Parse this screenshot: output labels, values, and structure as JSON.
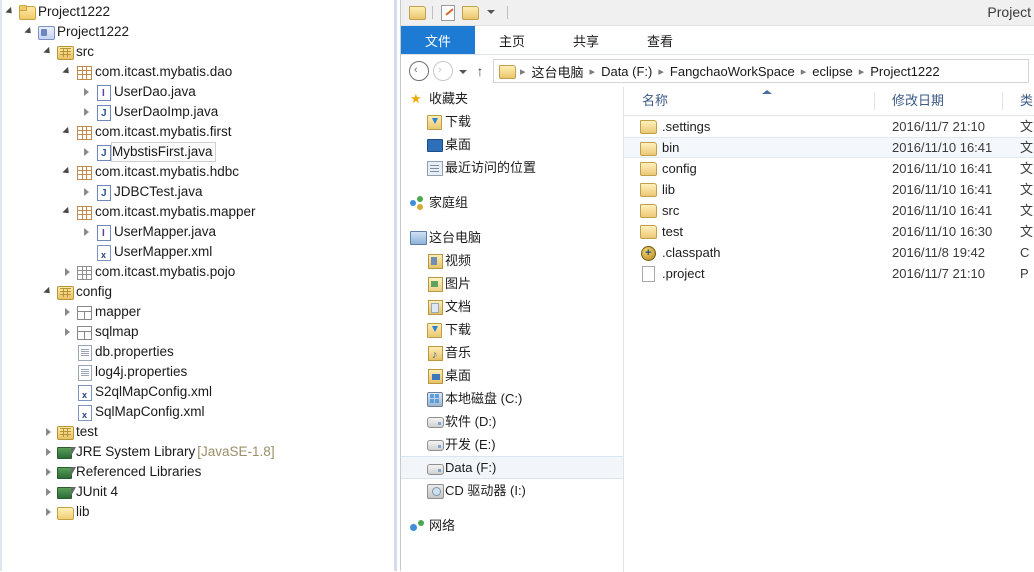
{
  "eclipse": {
    "tree": [
      {
        "depth": 0,
        "arrow": "expanded",
        "icon": "i-proj",
        "label": "Project1222"
      },
      {
        "depth": 1,
        "arrow": "expanded",
        "icon": "i-projj",
        "label": "Project1222"
      },
      {
        "depth": 2,
        "arrow": "expanded",
        "icon": "i-srcfolder",
        "label": "src"
      },
      {
        "depth": 3,
        "arrow": "expanded",
        "icon": "i-pkg",
        "label": "com.itcast.mybatis.dao"
      },
      {
        "depth": 4,
        "arrow": "collapsed",
        "icon": "i-iface",
        "label": "UserDao.java"
      },
      {
        "depth": 4,
        "arrow": "collapsed",
        "icon": "i-java",
        "label": "UserDaoImp.java"
      },
      {
        "depth": 3,
        "arrow": "expanded",
        "icon": "i-pkg",
        "label": "com.itcast.mybatis.first"
      },
      {
        "depth": 4,
        "arrow": "collapsed",
        "icon": "i-java",
        "label": "MybstisFirst.java",
        "selected": true
      },
      {
        "depth": 3,
        "arrow": "expanded",
        "icon": "i-pkg",
        "label": "com.itcast.mybatis.hdbc"
      },
      {
        "depth": 4,
        "arrow": "collapsed",
        "icon": "i-java",
        "label": "JDBCTest.java"
      },
      {
        "depth": 3,
        "arrow": "expanded",
        "icon": "i-pkg",
        "label": "com.itcast.mybatis.mapper"
      },
      {
        "depth": 4,
        "arrow": "collapsed",
        "icon": "i-iface",
        "label": "UserMapper.java"
      },
      {
        "depth": 4,
        "arrow": "none",
        "icon": "i-xml",
        "label": "UserMapper.xml"
      },
      {
        "depth": 3,
        "arrow": "collapsed",
        "icon": "i-pkg",
        "label": "com.itcast.mybatis.pojo"
      },
      {
        "depth": 2,
        "arrow": "expanded",
        "icon": "i-srcfolder",
        "label": "config"
      },
      {
        "depth": 3,
        "arrow": "collapsed",
        "icon": "i-mapfolder",
        "label": "mapper"
      },
      {
        "depth": 3,
        "arrow": "collapsed",
        "icon": "i-mapfolder",
        "label": "sqlmap"
      },
      {
        "depth": 3,
        "arrow": "none",
        "icon": "i-prop",
        "label": "db.properties"
      },
      {
        "depth": 3,
        "arrow": "none",
        "icon": "i-prop",
        "label": "log4j.properties"
      },
      {
        "depth": 3,
        "arrow": "none",
        "icon": "i-xml",
        "label": "S2qlMapConfig.xml"
      },
      {
        "depth": 3,
        "arrow": "none",
        "icon": "i-xml",
        "label": "SqlMapConfig.xml"
      },
      {
        "depth": 2,
        "arrow": "collapsed",
        "icon": "i-srcfolder",
        "label": "test"
      },
      {
        "depth": 2,
        "arrow": "collapsed",
        "icon": "i-lib",
        "label": "JRE System Library",
        "sublabel": "[JavaSE-1.8]"
      },
      {
        "depth": 2,
        "arrow": "collapsed",
        "icon": "i-lib",
        "label": "Referenced Libraries"
      },
      {
        "depth": 2,
        "arrow": "collapsed",
        "icon": "i-lib",
        "label": "JUnit 4"
      },
      {
        "depth": 2,
        "arrow": "collapsed",
        "icon": "i-folder",
        "label": "lib"
      }
    ]
  },
  "explorer": {
    "title": "Project",
    "quick_access": [
      {
        "name": "folder-icon",
        "class": "fico"
      },
      {
        "name": "properties-icon",
        "class": "pico"
      },
      {
        "name": "folder-icon",
        "class": "fico"
      },
      {
        "name": "chevron-down-icon",
        "class": "dico"
      }
    ],
    "ribbon_tabs": [
      {
        "label": "文件",
        "active": true
      },
      {
        "label": "主页",
        "active": false
      },
      {
        "label": "共享",
        "active": false
      },
      {
        "label": "查看",
        "active": false
      }
    ],
    "address": {
      "back_label": "‹",
      "forward_label": "›",
      "up_label": "↑",
      "crumbs": [
        "这台电脑",
        "Data (F:)",
        "FangchaoWorkSpace",
        "eclipse",
        "Project1222"
      ],
      "separator": "▸"
    },
    "nav_pane": [
      {
        "type": "item",
        "icon": "star",
        "label": "收藏夹",
        "indent": 0
      },
      {
        "type": "item",
        "icon": "dl",
        "label": "下载",
        "indent": 1
      },
      {
        "type": "item",
        "icon": "desk",
        "label": "桌面",
        "indent": 1
      },
      {
        "type": "item",
        "icon": "recent",
        "label": "最近访问的位置",
        "indent": 1
      },
      {
        "type": "gap"
      },
      {
        "type": "item",
        "icon": "homeg",
        "label": "家庭组",
        "indent": 0
      },
      {
        "type": "gap"
      },
      {
        "type": "item",
        "icon": "pc",
        "label": "这台电脑",
        "indent": 0
      },
      {
        "type": "item",
        "icon": "fvid",
        "label": "视频",
        "indent": 1
      },
      {
        "type": "item",
        "icon": "fpic",
        "label": "图片",
        "indent": 1
      },
      {
        "type": "item",
        "icon": "fdoc",
        "label": "文档",
        "indent": 1
      },
      {
        "type": "item",
        "icon": "dl",
        "label": "下载",
        "indent": 1
      },
      {
        "type": "item",
        "icon": "fmus",
        "label": "音乐",
        "indent": 1
      },
      {
        "type": "item",
        "icon": "fdesk",
        "label": "桌面",
        "indent": 1
      },
      {
        "type": "item",
        "icon": "hdd",
        "label": "本地磁盘 (C:)",
        "indent": 1
      },
      {
        "type": "item",
        "icon": "drv",
        "label": "软件 (D:)",
        "indent": 1
      },
      {
        "type": "item",
        "icon": "drv",
        "label": "开发 (E:)",
        "indent": 1
      },
      {
        "type": "item",
        "icon": "drv",
        "label": "Data (F:)",
        "indent": 1,
        "selected": true
      },
      {
        "type": "item",
        "icon": "cd",
        "label": "CD 驱动器 (I:)",
        "indent": 1
      },
      {
        "type": "gap"
      },
      {
        "type": "item",
        "icon": "net",
        "label": "网络",
        "indent": 0
      }
    ],
    "columns": [
      {
        "label": "名称",
        "key": "name"
      },
      {
        "label": "修改日期",
        "key": "date"
      },
      {
        "label": "类",
        "key": "type"
      }
    ],
    "sort_column": "名称",
    "sort_direction": "asc",
    "files": [
      {
        "icon": "folder",
        "name": ".settings",
        "date": "2016/11/7 21:10",
        "type": "文",
        "selected": false
      },
      {
        "icon": "folder",
        "name": "bin",
        "date": "2016/11/10 16:41",
        "type": "文",
        "selected": true
      },
      {
        "icon": "folder",
        "name": "config",
        "date": "2016/11/10 16:41",
        "type": "文",
        "selected": false
      },
      {
        "icon": "folder",
        "name": "lib",
        "date": "2016/11/10 16:41",
        "type": "文",
        "selected": false
      },
      {
        "icon": "folder",
        "name": "src",
        "date": "2016/11/10 16:41",
        "type": "文",
        "selected": false
      },
      {
        "icon": "folder",
        "name": "test",
        "date": "2016/11/10 16:30",
        "type": "文",
        "selected": false
      },
      {
        "icon": "globe",
        "name": ".classpath",
        "date": "2016/11/8 19:42",
        "type": "C",
        "selected": false
      },
      {
        "icon": "doc",
        "name": ".project",
        "date": "2016/11/7 21:10",
        "type": "P",
        "selected": false
      }
    ]
  }
}
